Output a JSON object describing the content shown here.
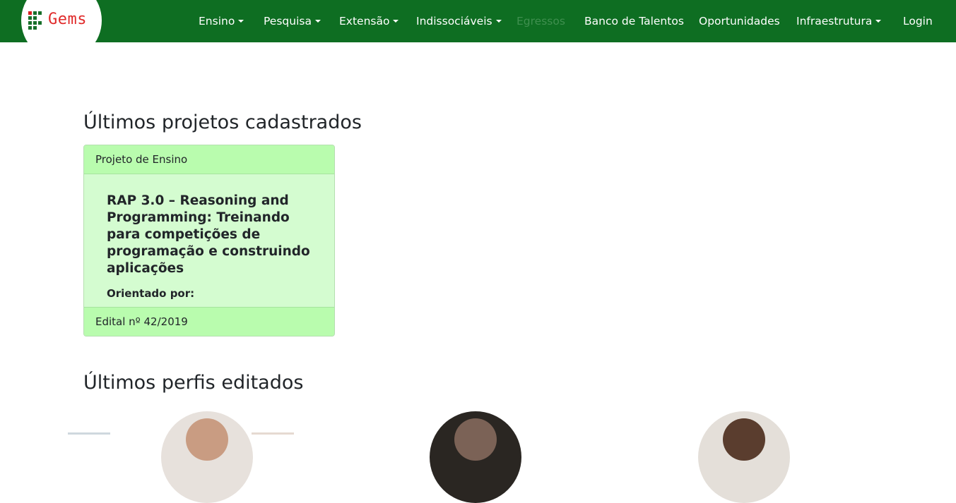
{
  "brand": {
    "name": "Gems",
    "text_color": "#e02a2a",
    "navbar_color": "#0e6e22"
  },
  "nav": {
    "items": [
      {
        "label": "Ensino",
        "dropdown": true
      },
      {
        "label": "Pesquisa",
        "dropdown": true
      },
      {
        "label": "Extensão",
        "dropdown": true
      },
      {
        "label": "Indissociáveis",
        "dropdown": true
      },
      {
        "label": "Egressos",
        "dropdown": false,
        "disabled": true
      },
      {
        "label": "Banco de Talentos",
        "dropdown": false
      },
      {
        "label": "Oportunidades",
        "dropdown": false
      },
      {
        "label": "Infraestrutura",
        "dropdown": true
      }
    ],
    "login": "Login"
  },
  "projects_section": {
    "title": "Últimos projetos cadastrados",
    "cards": [
      {
        "header": "Projeto de Ensino",
        "title": "RAP 3.0 – Reasoning and Programming: Treinando para competições de programação e construindo aplicações",
        "advisor_label": "Orientado por:",
        "footer": "Edital nº 42/2019"
      }
    ]
  },
  "profiles_section": {
    "title": "Últimos perfis editados",
    "avatars": [
      "avatar-1",
      "avatar-2",
      "avatar-3"
    ]
  }
}
